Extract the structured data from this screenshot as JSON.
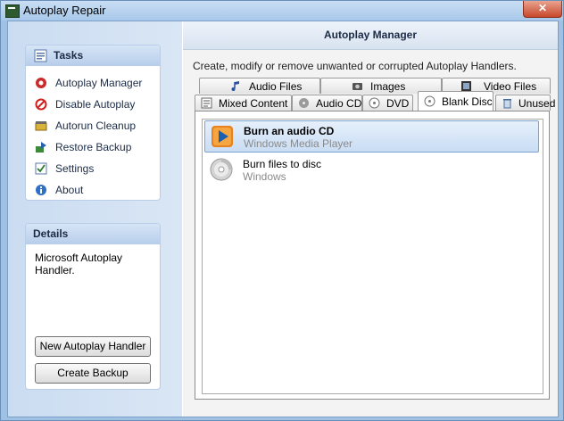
{
  "window": {
    "title": "Autoplay Repair",
    "close_glyph": "✕"
  },
  "tasks": {
    "header": "Tasks",
    "items": [
      {
        "label": "Autoplay Manager",
        "icon": "autoplay-manager-icon"
      },
      {
        "label": "Disable Autoplay",
        "icon": "disable-icon"
      },
      {
        "label": "Autorun Cleanup",
        "icon": "cleanup-icon"
      },
      {
        "label": "Restore Backup",
        "icon": "restore-icon"
      },
      {
        "label": "Settings",
        "icon": "settings-icon"
      },
      {
        "label": "About",
        "icon": "about-icon"
      }
    ]
  },
  "details": {
    "header": "Details",
    "text": "Microsoft Autoplay Handler."
  },
  "buttons": {
    "new_handler": "New Autoplay Handler",
    "create_backup": "Create Backup"
  },
  "main": {
    "header": "Autoplay Manager",
    "description": "Create, modify or remove unwanted or corrupted Autoplay Handlers.",
    "tabs_row1": [
      "Audio Files",
      "Images",
      "Video Files"
    ],
    "tabs_row2": [
      "Mixed Content",
      "Audio CD",
      "DVD",
      "Blank Disc",
      "Unused"
    ],
    "active_tab": "Blank Disc",
    "handlers": [
      {
        "title": "Burn an audio CD",
        "subtitle": "Windows Media Player",
        "selected": true
      },
      {
        "title": "Burn files to disc",
        "subtitle": "Windows",
        "selected": false
      }
    ]
  }
}
